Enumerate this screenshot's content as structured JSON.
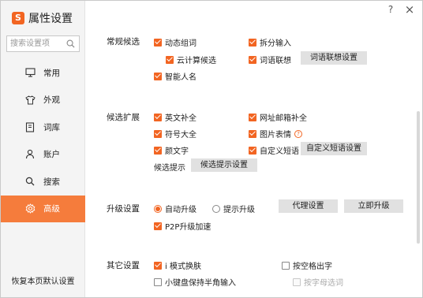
{
  "app": {
    "title": "属性设置",
    "logo_letter": "S"
  },
  "window_controls": {
    "help": "?",
    "close": "×"
  },
  "search": {
    "placeholder": "搜索设置项"
  },
  "nav": {
    "items": [
      {
        "label": "常用",
        "icon": "monitor-icon"
      },
      {
        "label": "外观",
        "icon": "shirt-icon"
      },
      {
        "label": "词库",
        "icon": "book-icon"
      },
      {
        "label": "账户",
        "icon": "user-icon"
      },
      {
        "label": "搜索",
        "icon": "search-icon"
      },
      {
        "label": "高级",
        "icon": "gear-icon",
        "active": true
      }
    ],
    "reset": "恢复本页默认设置"
  },
  "sections": {
    "candidates": {
      "title": "常规候选",
      "dynamic_phrase": "动态组词",
      "cloud_candidates": "云计算候选",
      "smart_name": "智能人名",
      "split_input": "拆分输入",
      "word_association": "词语联想",
      "word_association_btn": "词语联想设置"
    },
    "expansion": {
      "title": "候选扩展",
      "english_complete": "英文补全",
      "symbol_complete": "符号大全",
      "kaomoji": "颜文字",
      "url_email_complete": "网址邮箱补全",
      "image_emoji": "图片表情",
      "custom_phrase": "自定义短语",
      "custom_phrase_btn": "自定义短语设置",
      "hint_label": "候选提示",
      "hint_btn": "候选提示设置"
    },
    "upgrade": {
      "title": "升级设置",
      "auto_upgrade": "自动升级",
      "notify_upgrade": "提示升级",
      "proxy_btn": "代理设置",
      "upgrade_now_btn": "立即升级",
      "p2p": "P2P升级加速"
    },
    "other": {
      "title": "其它设置",
      "i_mode_skin": "i 模式换肤",
      "numpad_halfwidth": "小键盘保持半角输入",
      "space_output": "按空格出字",
      "alpha_select": "按字母选词"
    }
  },
  "colors": {
    "accent": "#f26522",
    "nav_active": "#f57c3c",
    "button_bg": "#e1e1e1"
  }
}
